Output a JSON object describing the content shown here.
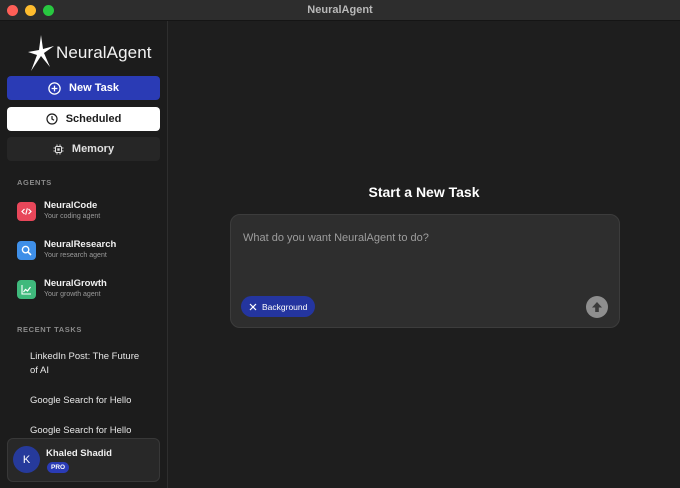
{
  "window": {
    "title": "NeuralAgent"
  },
  "sidebar": {
    "logo_text": "NeuralAgent",
    "new_task_label": "New Task",
    "scheduled_label": "Scheduled",
    "memory_label": "Memory",
    "agents_header": "AGENTS",
    "agents": [
      {
        "name": "NeuralCode",
        "subtitle": "Your coding agent",
        "color": "#e8475a",
        "icon": "code-icon"
      },
      {
        "name": "NeuralResearch",
        "subtitle": "Your research agent",
        "color": "#3f8fe8",
        "icon": "search-icon"
      },
      {
        "name": "NeuralGrowth",
        "subtitle": "Your growth agent",
        "color": "#3fb97c",
        "icon": "chart-icon"
      }
    ],
    "recent_header": "RECENT TASKS",
    "recent_tasks": [
      "LinkedIn Post: The Future of AI",
      "Google Search for Hello",
      "Google Search for Hello"
    ],
    "user": {
      "initial": "K",
      "name": "Khaled Shadid",
      "badge": "PRO"
    }
  },
  "main": {
    "heading": "Start a New Task",
    "input_placeholder": "What do you want NeuralAgent to do?",
    "input_value": "",
    "background_label": "Background"
  },
  "colors": {
    "accent": "#2a3bb5",
    "background": "#1e1e1e",
    "sidebar": "#1c1c1c"
  }
}
